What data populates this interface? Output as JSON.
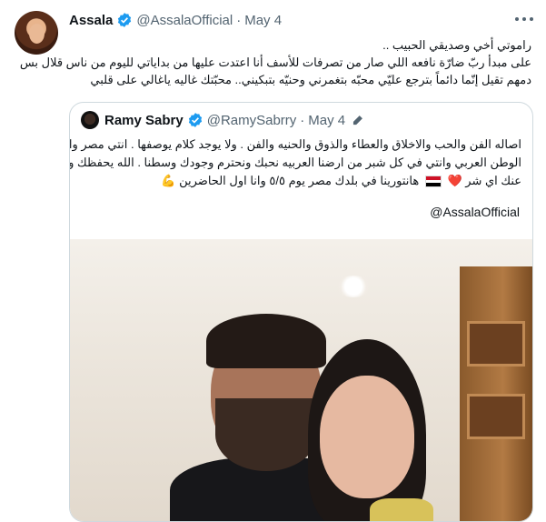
{
  "tweet": {
    "author_name": "Assala",
    "author_handle": "@AssalaOfficial",
    "separator": "·",
    "date": "May 4",
    "text_lines": [
      "راموتي أخي وصديقي الحبيب ..",
      "على مبدأ ربّ ضارّة نافعه اللي صار من تصرفات للأسف أنا اعتدت عليها من بداياتي لليوم من ناس قلال بس",
      "دمهم تقيل إنّما دائماً بترجع عليّي محبّه بتغمرني وحنيّه بتبكيني.. محبّتك غاليه ياغالي على قلبي"
    ]
  },
  "quote": {
    "author_name": "Ramy Sabry",
    "author_handle": "@RamySabrry",
    "separator": "·",
    "date": "May 4",
    "text_lines": [
      "اصاله الفن والحب والاخلاق والعطاء والذوق والحنيه والفن . ولا يوجد كلام يوصفها . انتي مصر وانتي",
      "الوطن العربي وانتي في كل شبر من ارضنا العربيه نحبك ونحترم وجودك وسطنا . الله يحفظك ويبعد",
      "عنك اي شر",
      "هانتورينا في بلدك مصر يوم ٥/٥ وانا اول الحاضرين"
    ],
    "heart_emoji": "❤️",
    "muscle_emoji": "💪",
    "mention": "@AssalaOfficial"
  },
  "icons": {
    "verified": "verified-badge-icon",
    "more": "more-options-icon",
    "edit": "edited-pencil-icon",
    "flag": "egypt-flag-icon"
  },
  "colors": {
    "verified_blue": "#1d9bf0",
    "secondary_text": "#536471",
    "border": "#cfd9de"
  }
}
